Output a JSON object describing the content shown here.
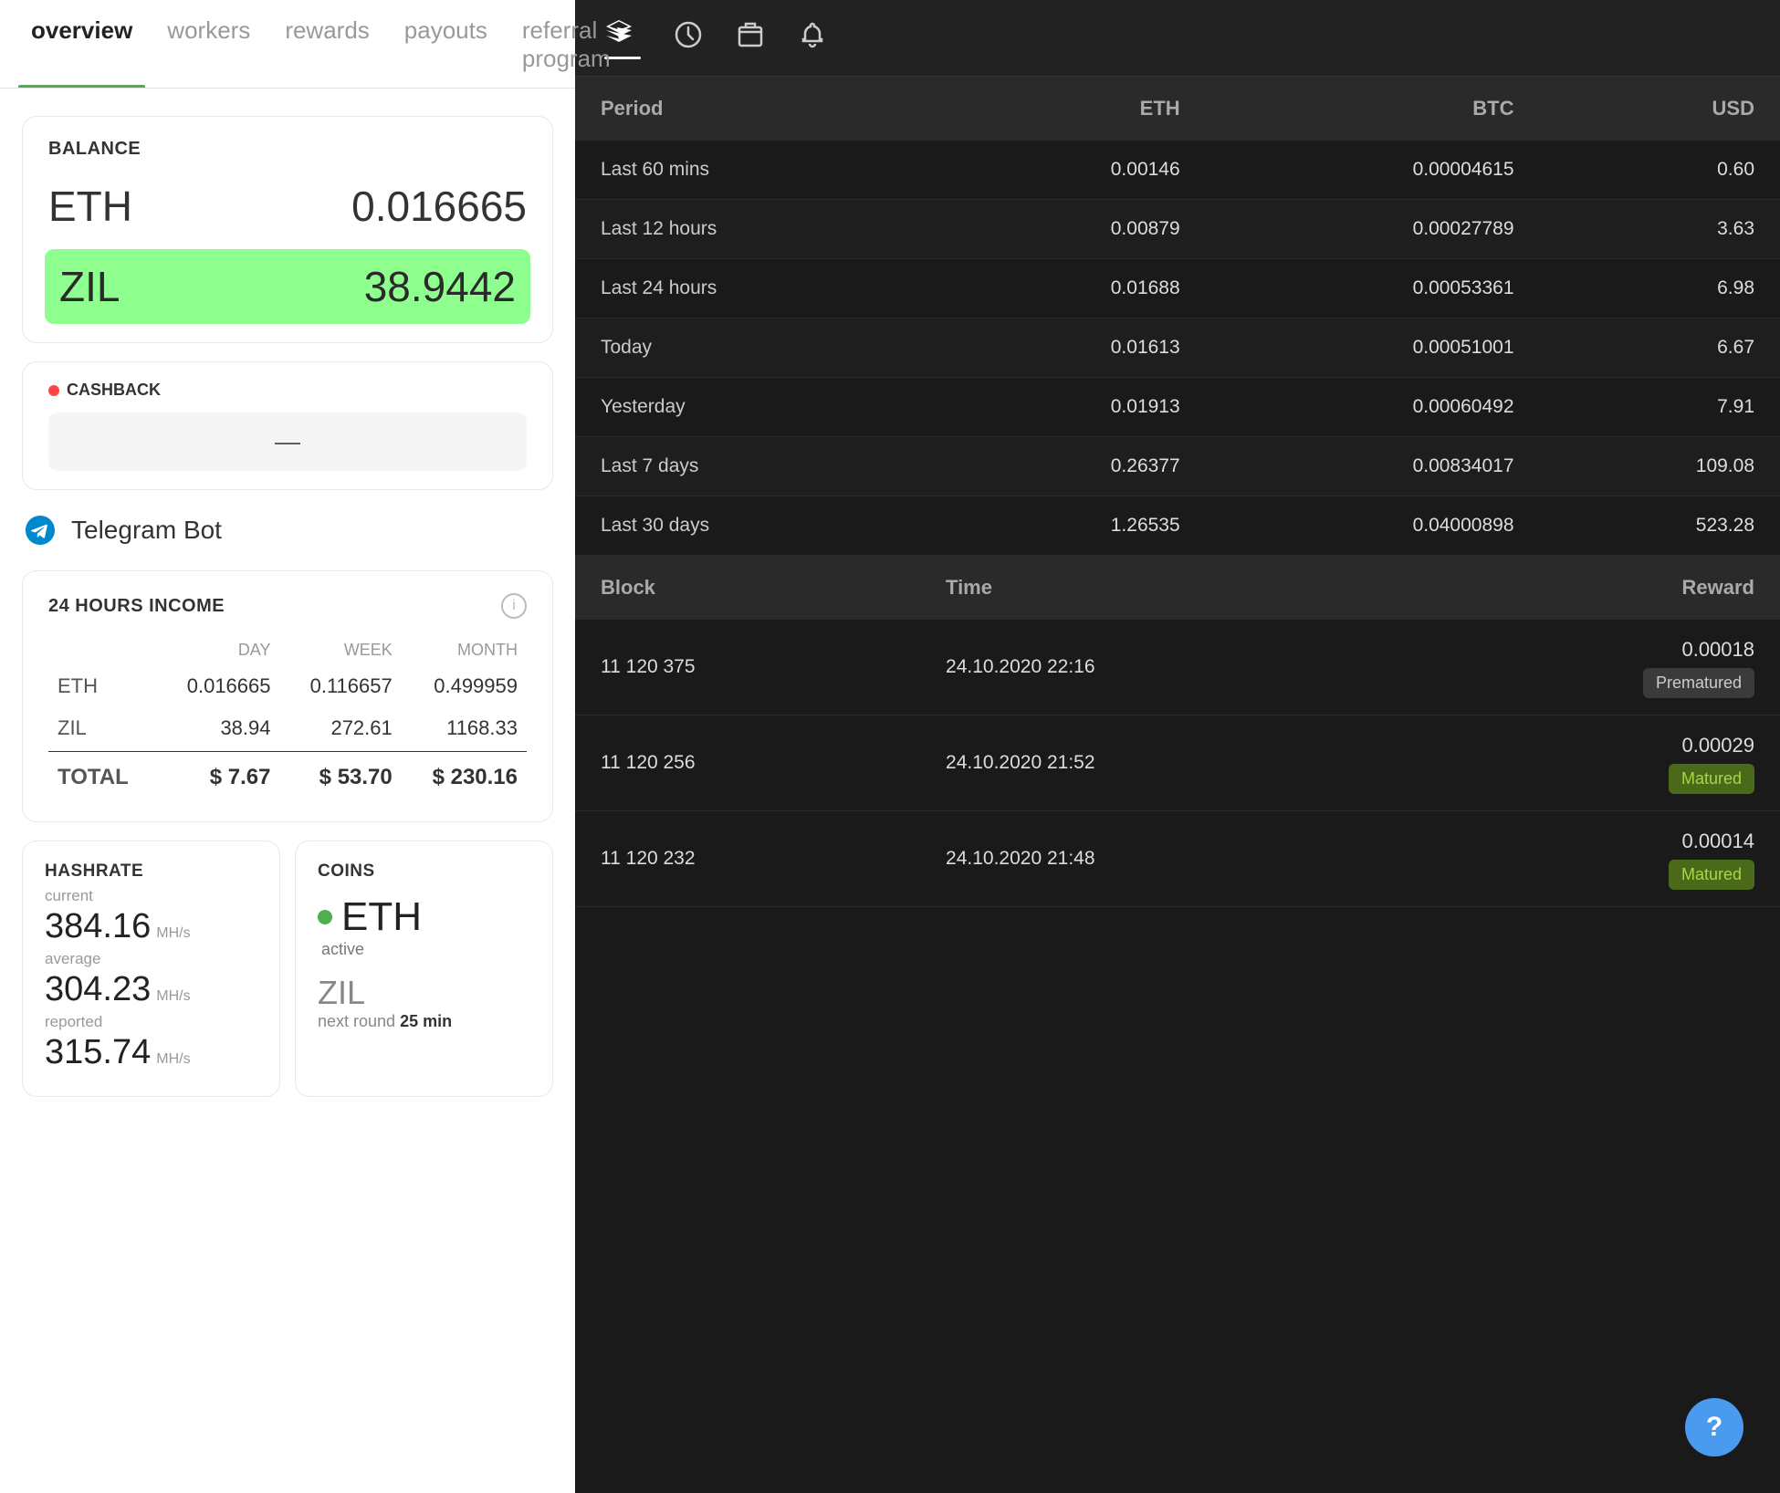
{
  "nav": {
    "tabs": [
      {
        "id": "overview",
        "label": "overview",
        "active": true
      },
      {
        "id": "workers",
        "label": "workers",
        "active": false
      },
      {
        "id": "rewards",
        "label": "rewards",
        "active": false
      },
      {
        "id": "payouts",
        "label": "payouts",
        "active": false
      },
      {
        "id": "referral",
        "label": "referral program",
        "active": false
      }
    ]
  },
  "balance": {
    "label": "BALANCE",
    "eth_currency": "ETH",
    "eth_value": "0.016665",
    "zil_currency": "ZIL",
    "zil_value": "38.9442"
  },
  "cashback": {
    "label": "CASHBACK",
    "value": "—"
  },
  "telegram": {
    "label": "Telegram Bot"
  },
  "income": {
    "title": "24 HOURS INCOME",
    "headers": {
      "label": "",
      "day": "DAY",
      "week": "WEEK",
      "month": "MONTH"
    },
    "rows": [
      {
        "currency": "ETH",
        "day": "0.016665",
        "week": "0.116657",
        "month": "0.499959"
      },
      {
        "currency": "ZIL",
        "day": "38.94",
        "week": "272.61",
        "month": "1168.33"
      },
      {
        "currency": "TOTAL",
        "day": "$ 7.67",
        "week": "$ 53.70",
        "month": "$ 230.16"
      }
    ]
  },
  "hashrate": {
    "title": "HASHRATE",
    "current_label": "current",
    "current_value": "384.16",
    "current_unit": "MH/s",
    "average_label": "average",
    "average_value": "304.23",
    "average_unit": "MH/s",
    "reported_label": "reported",
    "reported_value": "315.74",
    "reported_unit": "MH/s"
  },
  "coins": {
    "title": "COINS",
    "eth": {
      "name": "ETH",
      "status": "active",
      "dot_color": "#4CAF50"
    },
    "zil": {
      "name": "ZIL",
      "round_label": "next round",
      "round_value": "25 min"
    }
  },
  "right_panel": {
    "topbar_icons": [
      "layers",
      "circle-clock",
      "box",
      "bell"
    ],
    "earnings_table": {
      "headers": [
        "Period",
        "ETH",
        "BTC",
        "USD"
      ],
      "rows": [
        {
          "period": "Last 60 mins",
          "eth": "0.00146",
          "btc": "0.00004615",
          "usd": "0.60"
        },
        {
          "period": "Last 12 hours",
          "eth": "0.00879",
          "btc": "0.00027789",
          "usd": "3.63"
        },
        {
          "period": "Last 24 hours",
          "eth": "0.01688",
          "btc": "0.00053361",
          "usd": "6.98"
        },
        {
          "period": "Today",
          "eth": "0.01613",
          "btc": "0.00051001",
          "usd": "6.67"
        },
        {
          "period": "Yesterday",
          "eth": "0.01913",
          "btc": "0.00060492",
          "usd": "7.91"
        },
        {
          "period": "Last 7 days",
          "eth": "0.26377",
          "btc": "0.00834017",
          "usd": "109.08"
        },
        {
          "period": "Last 30 days",
          "eth": "1.26535",
          "btc": "0.04000898",
          "usd": "523.28"
        }
      ]
    },
    "blocks_table": {
      "headers": [
        "Block",
        "Time",
        "Reward"
      ],
      "rows": [
        {
          "block": "11 120 375",
          "time": "24.10.2020 22:16",
          "reward": "0.00018",
          "status": "Prematured",
          "status_type": "prematured"
        },
        {
          "block": "11 120 256",
          "time": "24.10.2020 21:52",
          "reward": "0.00029",
          "status": "Matured",
          "status_type": "matured"
        },
        {
          "block": "11 120 232",
          "time": "24.10.2020 21:48",
          "reward": "0.00014",
          "status": "Matured",
          "status_type": "matured"
        }
      ]
    }
  },
  "help": {
    "label": "?"
  }
}
